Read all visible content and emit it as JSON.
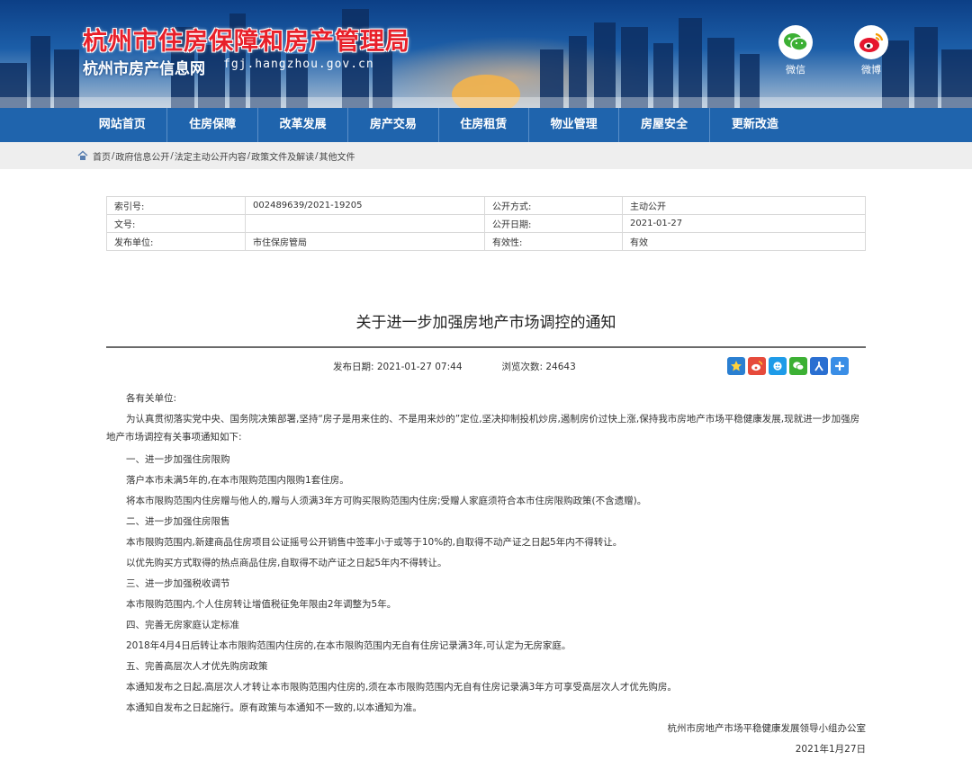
{
  "header": {
    "title": "杭州市住房保障和房产管理局",
    "subtitle": "杭州市房产信息网",
    "domain": "fgj.hangzhou.gov.cn",
    "wechat_label": "微信",
    "weibo_label": "微博"
  },
  "nav": {
    "items": [
      "网站首页",
      "住房保障",
      "改革发展",
      "房产交易",
      "住房租赁",
      "物业管理",
      "房屋安全",
      "更新改造"
    ]
  },
  "breadcrumb": [
    "首页",
    "政府信息公开",
    "法定主动公开内容",
    "政策文件及解读",
    "其他文件"
  ],
  "meta": {
    "index_label": "索引号:",
    "index_value": "002489639/2021-19205",
    "mode_label": "公开方式:",
    "mode_value": "主动公开",
    "docno_label": "文号:",
    "docno_value": "",
    "date_label": "公开日期:",
    "date_value": "2021-01-27",
    "issuer_label": "发布单位:",
    "issuer_value": "市住保房管局",
    "validity_label": "有效性:",
    "validity_value": "有效"
  },
  "article": {
    "title": "关于进一步加强房地产市场调控的通知",
    "pub_date": "发布日期: 2021-01-27 07:44",
    "views": "浏览次数: 24643",
    "paragraphs": [
      "各有关单位:",
      "为认真贯彻落实党中央、国务院决策部署,坚持“房子是用来住的、不是用来炒的”定位,坚决抑制投机炒房,遏制房价过快上涨,保持我市房地产市场平稳健康发展,现就进一步加强房地产市场调控有关事项通知如下:",
      "一、进一步加强住房限购",
      "落户本市未满5年的,在本市限购范围内限购1套住房。",
      "将本市限购范围内住房赠与他人的,赠与人须满3年方可购买限购范围内住房;受赠人家庭须符合本市住房限购政策(不含遗赠)。",
      "二、进一步加强住房限售",
      "本市限购范围内,新建商品住房项目公证摇号公开销售中签率小于或等于10%的,自取得不动产证之日起5年内不得转让。",
      "以优先购买方式取得的热点商品住房,自取得不动产证之日起5年内不得转让。",
      "三、进一步加强税收调节",
      "本市限购范围内,个人住房转让增值税征免年限由2年调整为5年。",
      "四、完善无房家庭认定标准",
      "2018年4月4日后转让本市限购范围内住房的,在本市限购范围内无自有住房记录满3年,可认定为无房家庭。",
      "五、完善高层次人才优先购房政策",
      "本通知发布之日起,高层次人才转让本市限购范围内住房的,须在本市限购范围内无自有住房记录满3年方可享受高层次人才优先购房。",
      "本通知自发布之日起施行。原有政策与本通知不一致的,以本通知为准。"
    ],
    "signature": "杭州市房地产市场平稳健康发展领导小组办公室",
    "sign_date": "2021年1月27日"
  },
  "colors": {
    "nav_bg": "#1f64ad",
    "title_red": "#e8202a",
    "crumb_bg": "#eeeeee"
  }
}
